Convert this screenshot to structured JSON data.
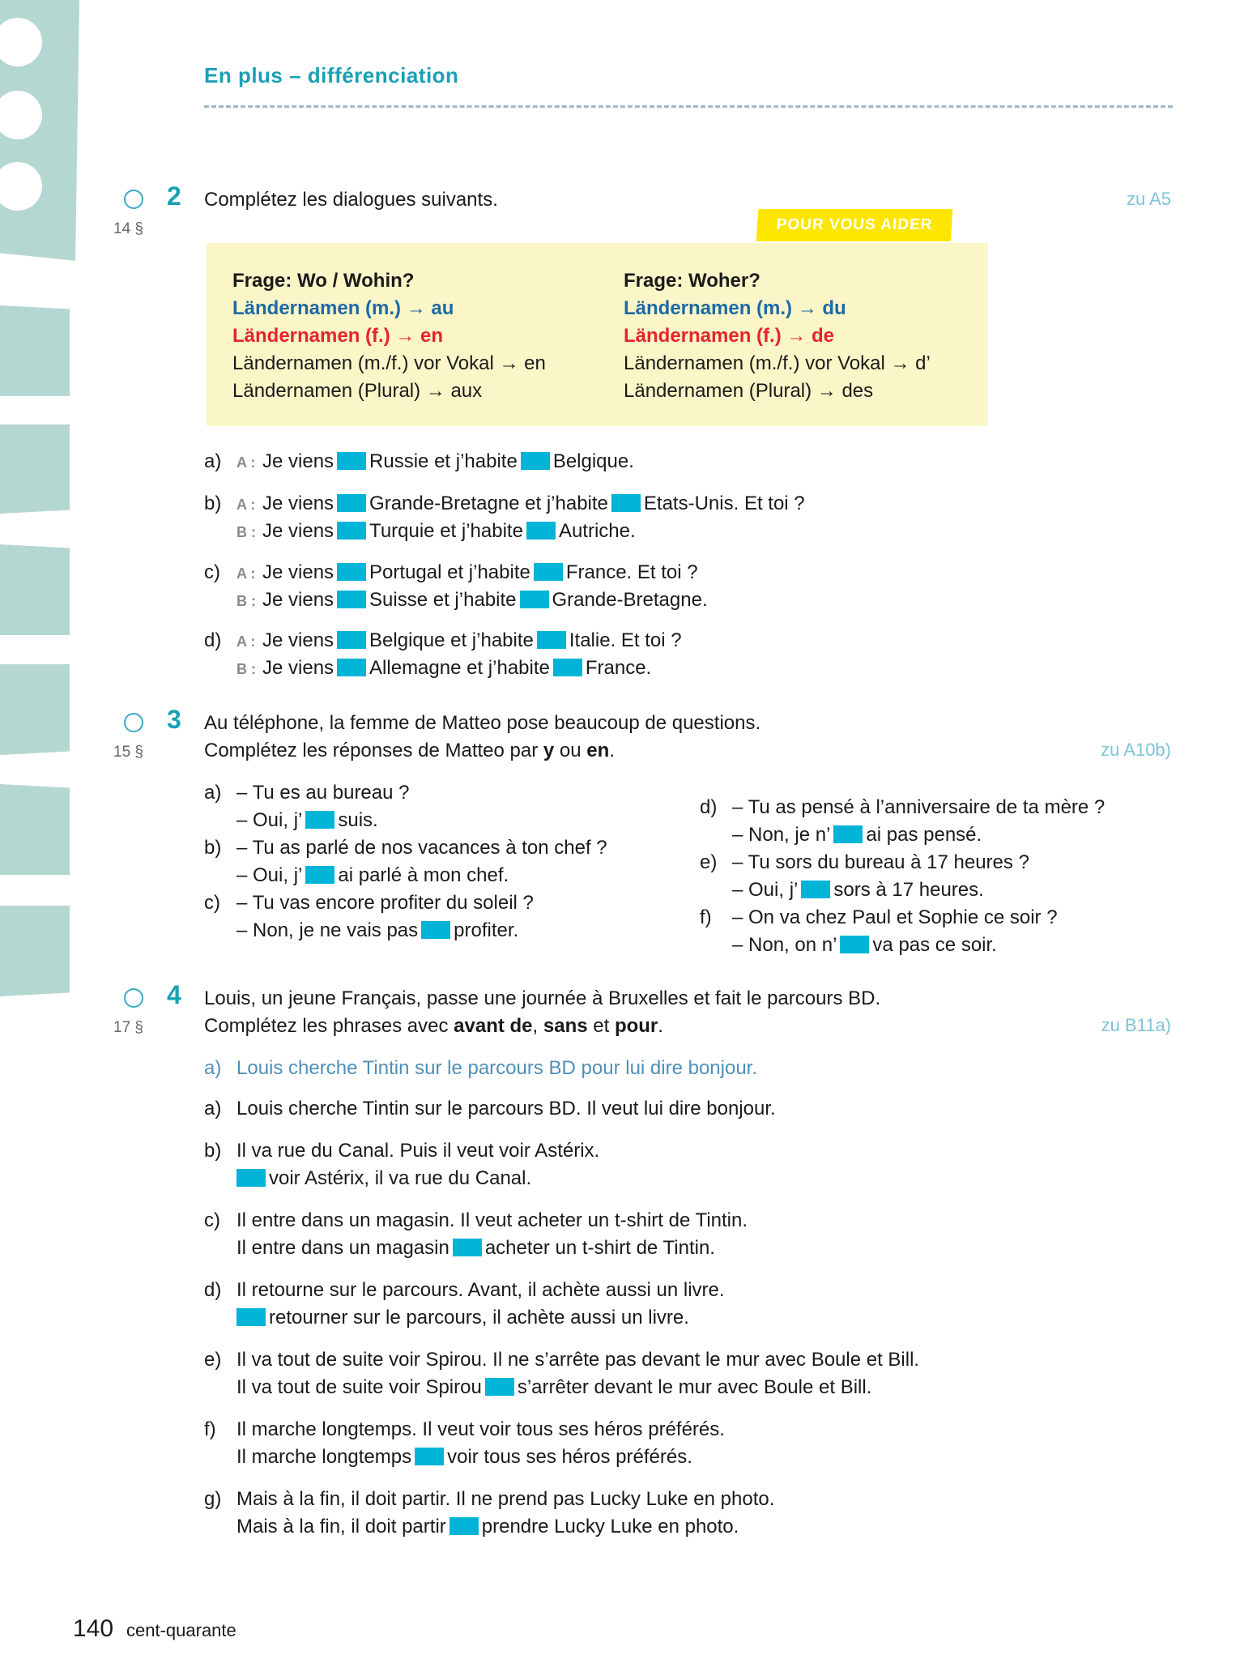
{
  "section_title": "En plus – différenciation",
  "help_tag": "POUR VOUS AIDER",
  "help": {
    "left": {
      "heading": "Frage: Wo / Wohin?",
      "m": "Ländernamen (m.) → au",
      "f": "Ländernamen (f.) → en",
      "vowel": "Ländernamen (m./f.) vor Vokal → en",
      "plural": "Ländernamen (Plural) → aux"
    },
    "right": {
      "heading": "Frage: Woher?",
      "m": "Ländernamen (m.) → du",
      "f": "Ländernamen (f.) → de",
      "vowel": "Ländernamen (m./f.) vor Vokal → d’",
      "plural": "Ländernamen (Plural) → des"
    }
  },
  "ex2": {
    "num": "2",
    "para": "14 §",
    "ref": "zu A5",
    "instruction": "Complétez les dialogues suivants.",
    "a": {
      "label": "a)",
      "spk": "A :",
      "p1": "Je viens",
      "p2": "Russie et j’habite",
      "p3": "Belgique."
    },
    "b": {
      "label": "b)",
      "A": {
        "spk": "A :",
        "p1": "Je viens",
        "p2": "Grande-Bretagne et j’habite",
        "p3": "Etats-Unis. Et toi ?"
      },
      "B": {
        "spk": "B :",
        "p1": "Je viens",
        "p2": "Turquie et j’habite",
        "p3": "Autriche."
      }
    },
    "c": {
      "label": "c)",
      "A": {
        "spk": "A :",
        "p1": "Je viens",
        "p2": "Portugal et j’habite",
        "p3": "France. Et toi ?"
      },
      "B": {
        "spk": "B :",
        "p1": "Je viens",
        "p2": "Suisse et j’habite",
        "p3": "Grande-Bretagne."
      }
    },
    "d": {
      "label": "d)",
      "A": {
        "spk": "A :",
        "p1": "Je viens",
        "p2": "Belgique et j’habite",
        "p3": "Italie. Et toi ?"
      },
      "B": {
        "spk": "B :",
        "p1": "Je viens",
        "p2": "Allemagne et j’habite",
        "p3": "France."
      }
    }
  },
  "ex3": {
    "num": "3",
    "para": "15 §",
    "ref": "zu A10b)",
    "instr1": "Au téléphone, la femme de Matteo pose beaucoup de questions.",
    "instr2a": "Complétez les réponses de Matteo par",
    "instr2y": "y",
    "instr2ou": "ou",
    "instr2en": "en",
    "instr2end": ".",
    "a": {
      "label": "a)",
      "q": "– Tu es au bureau ?",
      "r1": "– Oui, j’",
      "r2": "suis."
    },
    "b": {
      "label": "b)",
      "q": "– Tu as parlé de nos vacances à ton chef ?",
      "r1": "– Oui, j’",
      "r2": "ai parlé à mon chef."
    },
    "c": {
      "label": "c)",
      "q": "– Tu vas encore profiter du soleil ?",
      "r1": "– Non, je ne vais pas",
      "r2": "profiter."
    },
    "d": {
      "label": "d)",
      "q": "– Tu as pensé à l’anniversaire de ta mère ?",
      "r1": "– Non, je n’",
      "r2": "ai pas pensé."
    },
    "e": {
      "label": "e)",
      "q": "– Tu sors du bureau à 17 heures ?",
      "r1": "– Oui, j’",
      "r2": "sors à 17 heures."
    },
    "f": {
      "label": "f)",
      "q": "– On va chez Paul et Sophie ce soir ?",
      "r1": "– Non, on n’",
      "r2": "va pas ce soir."
    }
  },
  "ex4": {
    "num": "4",
    "para": "17 §",
    "ref": "zu B11a)",
    "instr1": "Louis, un jeune Français, passe une journée à Bruxelles et fait le parcours BD.",
    "instr2a": "Complétez les phrases avec",
    "kw1": "avant de",
    "sep1": ",",
    "kw2": "sans",
    "sep2": "et",
    "kw3": "pour",
    "end": ".",
    "example": {
      "label": "a)",
      "text": "Louis cherche Tintin sur le parcours BD pour lui dire bonjour."
    },
    "a": {
      "label": "a)",
      "l1": "Louis cherche Tintin sur le parcours BD. Il veut lui dire bonjour."
    },
    "b": {
      "label": "b)",
      "l1": "Il va rue du Canal. Puis il veut voir Astérix.",
      "l2a": "",
      "l2b": "voir Astérix, il va rue du Canal."
    },
    "c": {
      "label": "c)",
      "l1": "Il entre dans un magasin. Il veut acheter un t-shirt de Tintin.",
      "l2a": "Il entre dans un magasin",
      "l2b": "acheter un t-shirt de Tintin."
    },
    "d": {
      "label": "d)",
      "l1": "Il retourne sur le parcours. Avant, il achète aussi un livre.",
      "l2a": "",
      "l2b": "retourner sur le parcours, il achète aussi un livre."
    },
    "e": {
      "label": "e)",
      "l1": "Il va tout de suite voir Spirou. Il ne s’arrête pas devant le mur avec Boule et Bill.",
      "l2a": "Il va tout de suite voir Spirou",
      "l2b": "s’arrêter devant le mur avec Boule et Bill."
    },
    "f": {
      "label": "f)",
      "l1": "Il marche longtemps. Il veut voir tous ses héros préférés.",
      "l2a": "Il marche longtemps",
      "l2b": "voir tous ses héros préférés."
    },
    "g": {
      "label": "g)",
      "l1": "Mais à la fin, il doit partir. Il ne prend pas Lucky Luke en photo.",
      "l2a": "Mais à la fin, il doit partir",
      "l2b": "prendre Lucky Luke en photo."
    }
  },
  "footer": {
    "page": "140",
    "words": "cent-quarante"
  },
  "colors": {
    "accent": "#1aa0b4",
    "gap": "#00b4d8",
    "help_bg": "#fbf6c7",
    "tag": "#ffe600",
    "deco": "#b5d7d1"
  }
}
